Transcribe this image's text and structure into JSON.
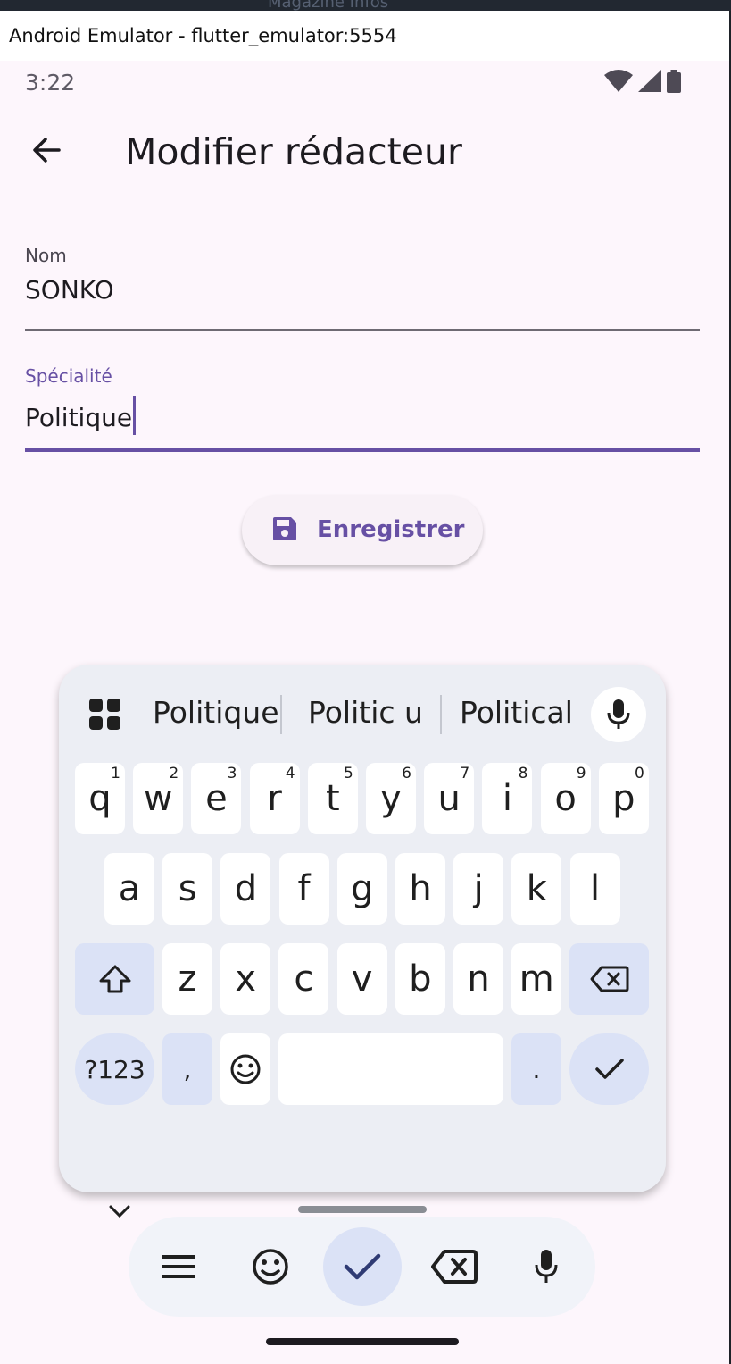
{
  "os": {
    "ghost_text": "Magazine Infos"
  },
  "window": {
    "title": "Android Emulator - flutter_emulator:5554"
  },
  "status_bar": {
    "time": "3:22",
    "icons": [
      "wifi-icon",
      "signal-icon",
      "battery-icon"
    ]
  },
  "appbar": {
    "back_icon": "arrow-back-icon",
    "title": "Modifier rédacteur"
  },
  "form": {
    "nom": {
      "label": "Nom",
      "value": "SONKO"
    },
    "specialite": {
      "label": "Spécialité",
      "value": "Politique"
    }
  },
  "save_button": {
    "icon": "save-icon",
    "label": "Enregistrer"
  },
  "keyboard": {
    "suggestions": [
      "Politique",
      "Politic u",
      "Political"
    ],
    "row1": [
      {
        "k": "q",
        "h": "1"
      },
      {
        "k": "w",
        "h": "2"
      },
      {
        "k": "e",
        "h": "3"
      },
      {
        "k": "r",
        "h": "4"
      },
      {
        "k": "t",
        "h": "5"
      },
      {
        "k": "y",
        "h": "6"
      },
      {
        "k": "u",
        "h": "7"
      },
      {
        "k": "i",
        "h": "8"
      },
      {
        "k": "o",
        "h": "9"
      },
      {
        "k": "p",
        "h": "0"
      }
    ],
    "row2": [
      "a",
      "s",
      "d",
      "f",
      "g",
      "h",
      "j",
      "k",
      "l"
    ],
    "row3": [
      "z",
      "x",
      "c",
      "v",
      "b",
      "n",
      "m"
    ],
    "row4": {
      "symbols": "?123",
      "comma": ",",
      "period": "."
    }
  },
  "colors": {
    "accent": "#6750a4",
    "background": "#fdf6fc",
    "keyboard": "#eceef4",
    "function_key": "#dbe2f6"
  }
}
